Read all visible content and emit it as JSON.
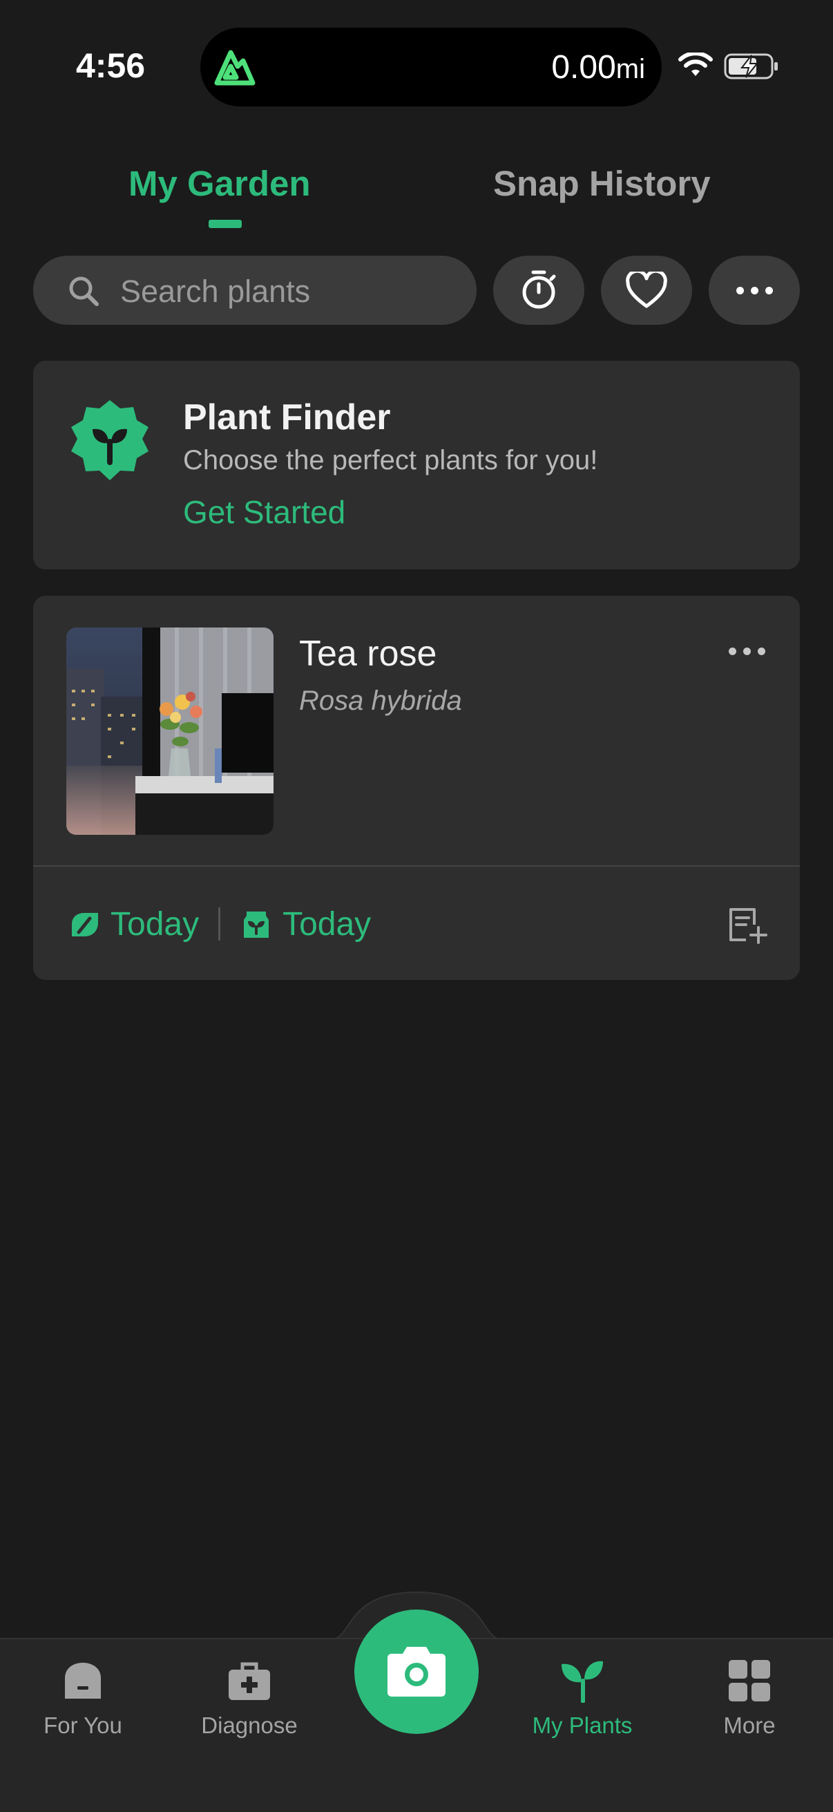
{
  "status_bar": {
    "time": "4:56",
    "distance_value": "0.00",
    "distance_unit": "mi",
    "island_icon": "peak-logo-icon",
    "wifi_icon": "wifi-icon",
    "battery_icon": "battery-charging-icon"
  },
  "tabs": [
    {
      "label": "My Garden",
      "active": true
    },
    {
      "label": "Snap History",
      "active": false
    }
  ],
  "search": {
    "placeholder": "Search plants",
    "icon": "search-icon"
  },
  "toolbar": {
    "timer_icon": "stopwatch-icon",
    "favorite_icon": "heart-icon",
    "more_icon": "more-horizontal-icon"
  },
  "plant_finder": {
    "title": "Plant Finder",
    "subtitle": "Choose the perfect plants for you!",
    "cta": "Get Started",
    "icon": "plant-badge-icon"
  },
  "plants": [
    {
      "name": "Tea rose",
      "scientific_name": "Rosa hybrida",
      "watering": "Today",
      "fertilizing": "Today",
      "water_icon": "watering-icon",
      "fertilize_icon": "fertilizer-icon",
      "note_icon": "add-note-icon"
    }
  ],
  "bottom_nav": [
    {
      "label": "For You",
      "icon": "home-icon",
      "active": false
    },
    {
      "label": "Diagnose",
      "icon": "first-aid-kit-icon",
      "active": false
    },
    {
      "label": "",
      "icon": "camera-icon",
      "active": false
    },
    {
      "label": "My Plants",
      "icon": "sprout-icon",
      "active": true
    },
    {
      "label": "More",
      "icon": "grid-icon",
      "active": false
    }
  ],
  "colors": {
    "accent": "#2dbb7c",
    "background": "#1b1b1b",
    "card": "#2e2e2e",
    "control": "#3b3b3b",
    "nav_background": "#262626",
    "muted_text": "#a4a4a4"
  }
}
